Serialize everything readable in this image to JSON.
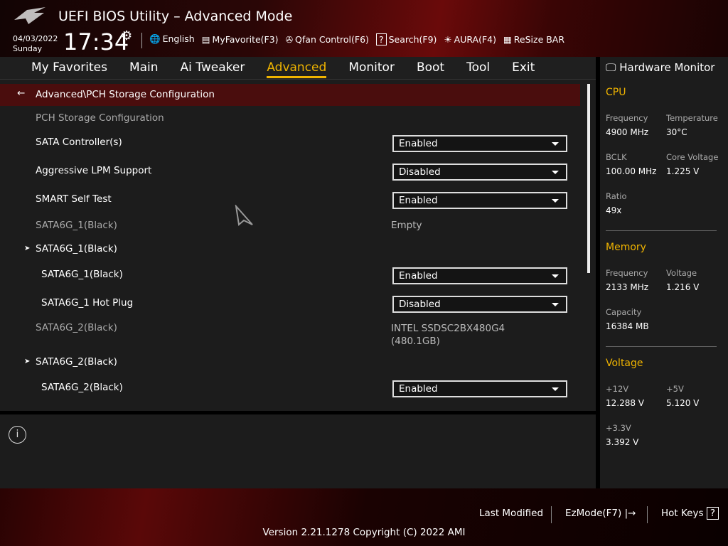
{
  "header": {
    "title": "UEFI BIOS Utility – Advanced Mode",
    "date": "04/03/2022",
    "day": "Sunday",
    "time": "17:34",
    "tools": [
      {
        "icon": "globe-icon",
        "glyph": "🌐",
        "label": "English"
      },
      {
        "icon": "favorite-list-icon",
        "glyph": "▤",
        "label": "MyFavorite(F3)"
      },
      {
        "icon": "fan-icon",
        "glyph": "✇",
        "label": "Qfan Control(F6)"
      },
      {
        "icon": "search-help-icon",
        "glyph": "?",
        "label": "Search(F9)"
      },
      {
        "icon": "aura-light-icon",
        "glyph": "☀",
        "label": "AURA(F4)"
      },
      {
        "icon": "resize-bar-icon",
        "glyph": "▦",
        "label": "ReSize BAR"
      }
    ]
  },
  "nav": [
    "My Favorites",
    "Main",
    "Ai Tweaker",
    "Advanced",
    "Monitor",
    "Boot",
    "Tool",
    "Exit"
  ],
  "active_tab": "Advanced",
  "breadcrumb": "Advanced\\PCH Storage Configuration",
  "settings": {
    "section": "PCH Storage Configuration",
    "sata_controller": {
      "label": "SATA Controller(s)",
      "value": "Enabled"
    },
    "lpm": {
      "label": "Aggressive LPM Support",
      "value": "Disabled"
    },
    "smart": {
      "label": "SMART Self Test",
      "value": "Enabled"
    },
    "port1_info": {
      "label": "SATA6G_1(Black)",
      "value": "Empty"
    },
    "port1_group": "SATA6G_1(Black)",
    "port1": {
      "label": "SATA6G_1(Black)",
      "value": "Enabled"
    },
    "port1_hotplug": {
      "label": "SATA6G_1 Hot Plug",
      "value": "Disabled"
    },
    "port2_info": {
      "label": "SATA6G_2(Black)",
      "value1": "INTEL SSDSC2BX480G4",
      "value2": "(480.1GB)"
    },
    "port2_group": "SATA6G_2(Black)",
    "port2": {
      "label": "SATA6G_2(Black)",
      "value": "Enabled"
    }
  },
  "monitor": {
    "title": "Hardware Monitor",
    "cpu": {
      "title": "CPU",
      "freq_l": "Frequency",
      "freq": "4900 MHz",
      "temp_l": "Temperature",
      "temp": "30°C",
      "bclk_l": "BCLK",
      "bclk": "100.00 MHz",
      "cv_l": "Core Voltage",
      "cv": "1.225 V",
      "ratio_l": "Ratio",
      "ratio": "49x"
    },
    "memory": {
      "title": "Memory",
      "freq_l": "Frequency",
      "freq": "2133 MHz",
      "volt_l": "Voltage",
      "volt": "1.216 V",
      "cap_l": "Capacity",
      "cap": "16384 MB"
    },
    "voltage": {
      "title": "Voltage",
      "v12_l": "+12V",
      "v12": "12.288 V",
      "v5_l": "+5V",
      "v5": "5.120 V",
      "v33_l": "+3.3V",
      "v33": "3.392 V"
    }
  },
  "footer": {
    "last_modified": "Last Modified",
    "ezmode": "EzMode(F7)",
    "hotkeys": "Hot Keys",
    "version": "Version 2.21.1278 Copyright (C) 2022 AMI"
  },
  "colors": {
    "accent": "#f0b400",
    "breadcrumb_bg": "#4a0d0d"
  }
}
